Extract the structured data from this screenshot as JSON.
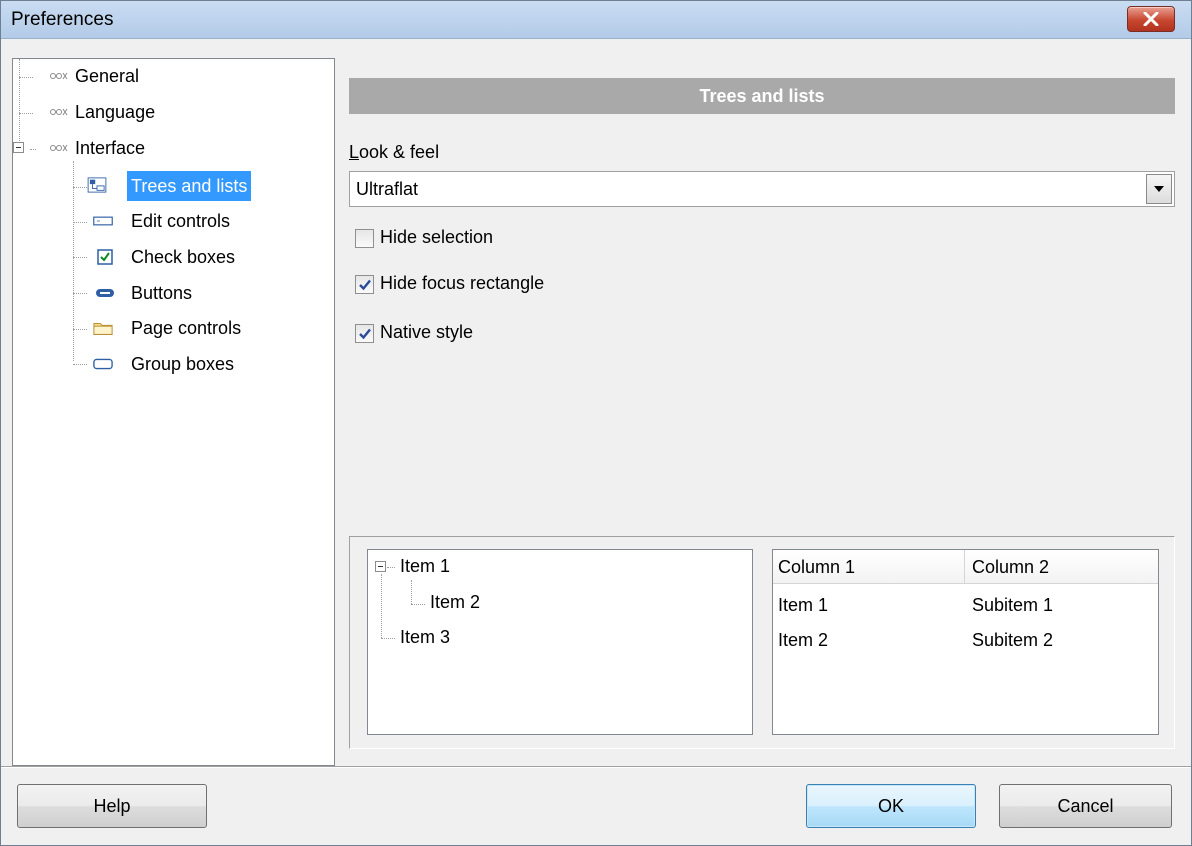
{
  "window": {
    "title": "Preferences",
    "close_icon": "close-icon"
  },
  "nav_tree": {
    "items": [
      {
        "label": "General",
        "icon": "keys-icon"
      },
      {
        "label": "Language",
        "icon": "keys-icon"
      },
      {
        "label": "Interface",
        "icon": "keys-icon",
        "expanded": true
      },
      {
        "label": "Trees and lists",
        "icon": "tree-list-icon",
        "selected": true
      },
      {
        "label": "Edit controls",
        "icon": "edit-control-icon"
      },
      {
        "label": "Check boxes",
        "icon": "checkbox-icon"
      },
      {
        "label": "Buttons",
        "icon": "button-icon"
      },
      {
        "label": "Page controls",
        "icon": "folder-tab-icon"
      },
      {
        "label": "Group boxes",
        "icon": "group-box-icon"
      }
    ]
  },
  "panel": {
    "header": "Trees and lists",
    "look_feel_label": "Look & feel",
    "look_feel_value": "Ultraflat",
    "options": [
      {
        "label": "Hide selection",
        "checked": false
      },
      {
        "label": "Hide focus rectangle",
        "checked": true
      },
      {
        "label": "Native style",
        "checked": true
      }
    ]
  },
  "preview_tree": {
    "items": [
      "Item 1",
      "Item 2",
      "Item 3"
    ]
  },
  "preview_list": {
    "columns": [
      "Column 1",
      "Column 2"
    ],
    "rows": [
      [
        "Item 1",
        "Subitem 1"
      ],
      [
        "Item 2",
        "Subitem 2"
      ]
    ]
  },
  "buttons": {
    "help": "Help",
    "ok": "OK",
    "cancel": "Cancel"
  },
  "colors": {
    "selection": "#3399ff",
    "header_bar": "#a9a9a9",
    "title_bar": "#c9dcf2",
    "close_button": "#c8472f"
  }
}
